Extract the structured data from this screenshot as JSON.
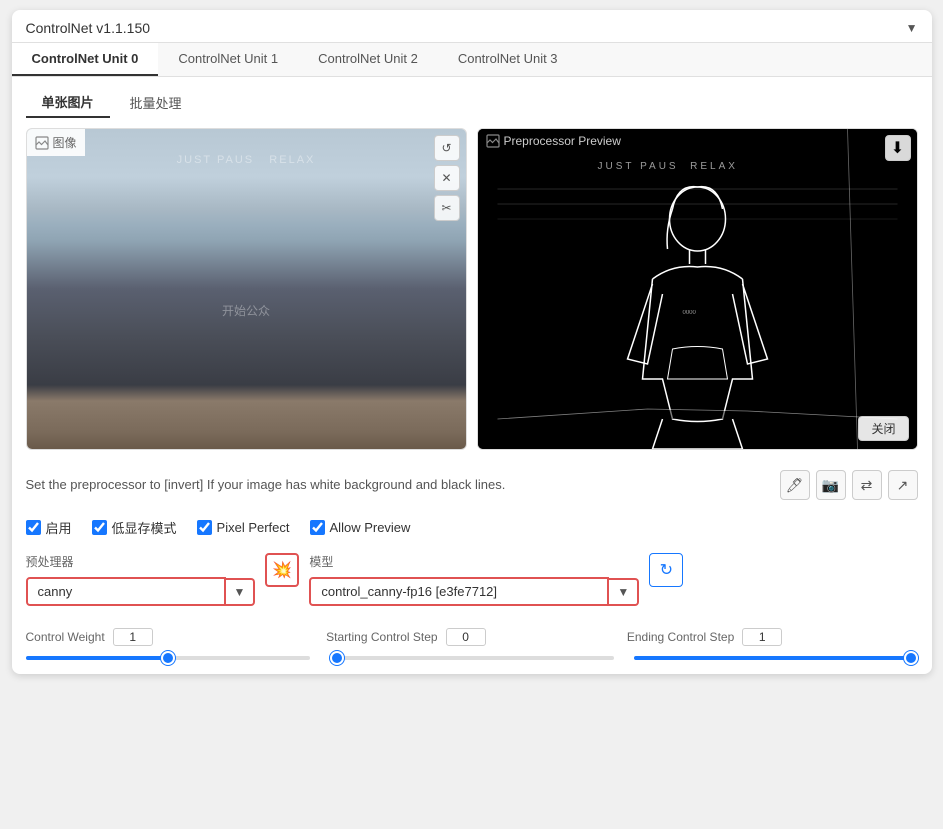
{
  "title": "ControlNet v1.1.150",
  "collapse_icon": "▼",
  "unit_tabs": [
    {
      "label": "ControlNet Unit 0",
      "active": true
    },
    {
      "label": "ControlNet Unit 1",
      "active": false
    },
    {
      "label": "ControlNet Unit 2",
      "active": false
    },
    {
      "label": "ControlNet Unit 3",
      "active": false
    }
  ],
  "inner_tabs": [
    {
      "label": "单张图片",
      "active": true
    },
    {
      "label": "批量处理",
      "active": false
    }
  ],
  "image_panel": {
    "left_label": "图像",
    "right_label": "Preprocessor Preview",
    "close_label": "关闭"
  },
  "info_text": "Set the preprocessor to [invert] If your image has white background and black lines.",
  "checkboxes": [
    {
      "label": "启用",
      "checked": true
    },
    {
      "label": "低显存模式",
      "checked": true
    },
    {
      "label": "Pixel Perfect",
      "checked": true
    },
    {
      "label": "Allow Preview",
      "checked": true
    }
  ],
  "preprocessor": {
    "label": "预处理器",
    "value": "canny",
    "placeholder": "canny"
  },
  "model": {
    "label": "模型",
    "value": "control_canny-fp16 [e3fe7712]",
    "placeholder": "control_canny-fp16 [e3fe7712]"
  },
  "sliders": {
    "control_weight": {
      "label": "Control Weight",
      "value": 1,
      "min": 0,
      "max": 2,
      "percent": 50
    },
    "starting_control_step": {
      "label": "Starting Control Step",
      "value": 0,
      "min": 0,
      "max": 1,
      "percent": 0
    },
    "ending_control_step": {
      "label": "Ending Control Step",
      "value": 1,
      "min": 0,
      "max": 1,
      "percent": 100
    }
  },
  "buttons": {
    "fire": "💥",
    "refresh": "↻",
    "rotate": "⇄",
    "curve_up": "↗",
    "camera": "📷",
    "pencil": "✏️",
    "download": "⬇"
  }
}
